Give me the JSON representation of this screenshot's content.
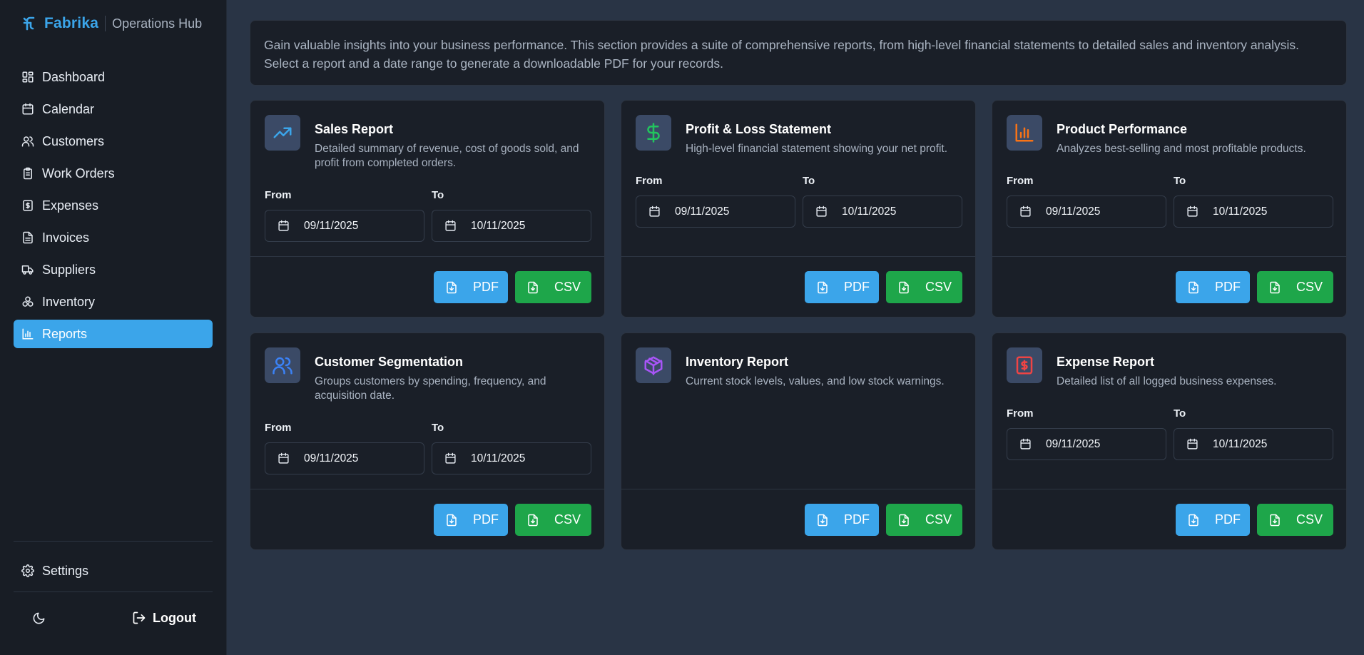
{
  "brand": {
    "name": "Fabrika",
    "subtitle": "Operations Hub"
  },
  "sidebar": {
    "items": [
      {
        "label": "Dashboard",
        "icon": "dashboard-icon"
      },
      {
        "label": "Calendar",
        "icon": "calendar-icon"
      },
      {
        "label": "Customers",
        "icon": "users-icon"
      },
      {
        "label": "Work Orders",
        "icon": "clipboard-icon"
      },
      {
        "label": "Expenses",
        "icon": "dollar-receipt-icon"
      },
      {
        "label": "Invoices",
        "icon": "file-text-icon"
      },
      {
        "label": "Suppliers",
        "icon": "truck-icon"
      },
      {
        "label": "Inventory",
        "icon": "boxes-icon"
      },
      {
        "label": "Reports",
        "icon": "bar-chart-icon",
        "active": true
      }
    ],
    "settings_label": "Settings",
    "logout_label": "Logout"
  },
  "intro": {
    "text": "Gain valuable insights into your business performance. This section provides a suite of comprehensive reports, from high-level financial statements to detailed sales and inventory analysis. Select a report and a date range to generate a downloadable PDF for your records."
  },
  "labels": {
    "from": "From",
    "to": "To",
    "pdf": "PDF",
    "csv": "CSV"
  },
  "reports": [
    {
      "title": "Sales Report",
      "description": "Detailed summary of revenue, cost of goods sold, and profit from completed orders.",
      "icon": "trending-up-icon",
      "icon_color": "#3ba5ea",
      "has_dates": true,
      "from": "09/11/2025",
      "to": "10/11/2025"
    },
    {
      "title": "Profit & Loss Statement",
      "description": "High-level financial statement showing your net profit.",
      "icon": "dollar-icon",
      "icon_color": "#22c55e",
      "has_dates": true,
      "from": "09/11/2025",
      "to": "10/11/2025"
    },
    {
      "title": "Product Performance",
      "description": "Analyzes best-selling and most profitable products.",
      "icon": "bar-chart-icon",
      "icon_color": "#f97316",
      "has_dates": true,
      "from": "09/11/2025",
      "to": "10/11/2025"
    },
    {
      "title": "Customer Segmentation",
      "description": "Groups customers by spending, frequency, and acquisition date.",
      "icon": "users-icon",
      "icon_color": "#3b82f6",
      "has_dates": true,
      "from": "09/11/2025",
      "to": "10/11/2025"
    },
    {
      "title": "Inventory Report",
      "description": "Current stock levels, values, and low stock warnings.",
      "icon": "package-icon",
      "icon_color": "#a855f7",
      "has_dates": false
    },
    {
      "title": "Expense Report",
      "description": "Detailed list of all logged business expenses.",
      "icon": "dollar-receipt-icon",
      "icon_color": "#ef4444",
      "has_dates": true,
      "from": "09/11/2025",
      "to": "10/11/2025"
    }
  ],
  "colors": {
    "accent": "#3ba5ea",
    "success": "#1ea64a",
    "sidebar_bg": "#181d25",
    "page_bg": "#293445",
    "card_bg": "#1a1f28"
  }
}
